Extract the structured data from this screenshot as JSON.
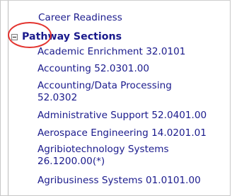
{
  "tree": {
    "top_item": "Career Readiness",
    "group": {
      "label": "Pathway Sections",
      "toggle_state": "expanded",
      "children": [
        "Academic Enrichment 32.0101",
        "Accounting 52.0301.00",
        "Accounting/Data Processing 52.0302",
        "Administrative Support 52.0401.00",
        "Aerospace Engineering 14.0201.01",
        "Agribiotechnology Systems 26.1200.00(*)",
        "Agribusiness Systems 01.0101.00"
      ]
    }
  },
  "colors": {
    "link": "#1a1a8c",
    "highlight": "#e3342f",
    "border": "#c8c8c8"
  },
  "icons": {
    "toggle": "minus-box-icon"
  }
}
